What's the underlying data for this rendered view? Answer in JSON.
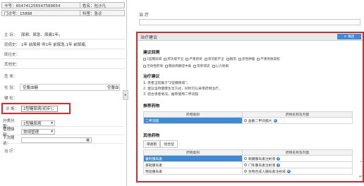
{
  "patient": {
    "card_label": "卡号：654741256547589654",
    "name_label": "姓名：包沙凡",
    "outpatient_label": "门诊号：15888",
    "dept_label": "科室：急诊"
  },
  "history": {
    "chief_label": "主 诉：",
    "chief_value": "尿频、尿急、尿痛1年。",
    "present_label": "现病史：",
    "present_value": "1年 前尿频 伴1年 前尿急,1年 前尿痛,",
    "past_label": "既往史：",
    "other_label": "其他史：",
    "exam_label": "查 体：",
    "lab_label": "化 验：",
    "lab_value": "空腹血糖",
    "lab_value2": "空腹血",
    "aux_label": "辅 检：",
    "diag_label": "诊 断：",
    "diag_value": "2型糖尿病(初步)；"
  },
  "classification": {
    "type_label": "分类分型：",
    "type_value": "2型糖尿病",
    "manage_label": "管理级别：",
    "manage_value": "常规管理",
    "followup_label": "下次随访：",
    "treat_label": "治 疗："
  },
  "right": {
    "treat_title": "治 疗"
  },
  "suggestion": {
    "title": "治疗建议",
    "confirm_label": "确定",
    "cause_title": "建议回溯",
    "causes_row1": [
      "1型糖尿病",
      "肝功能不全",
      "严重感染",
      "肾功能不全",
      "酮酒",
      "恶性肿瘤",
      "严重骨质疏松"
    ],
    "causes_row2": [
      "活动性肝病",
      "糖尿病酮症中毒",
      "有肝病史",
      "心力衰竭"
    ],
    "advice_title": "治疗建议",
    "advice_lines": [
      "1. 患者当前属于\"2型糖尿病\"。",
      "2. 建议坚持健康生活方式，同时可以采用药物治疗。",
      "3. 结合患者情况，推荐使用二甲双胍"
    ],
    "recommend_title": "推荐药物",
    "rec_headers": [
      "药物类别",
      "药物名称及剂量"
    ],
    "rec_rows": [
      {
        "category": "二甲双胍",
        "drug": "盐酸二甲双胍片"
      }
    ],
    "other_title": "其他药物",
    "tabs": [
      "单类别",
      "组合型"
    ],
    "other_headers": [
      "药物类别",
      "药物名称及剂量"
    ],
    "other_rows": [
      {
        "category": "餐时胰岛素",
        "drug": "赖脯胰岛素注射液"
      },
      {
        "category": "基础胰岛素",
        "drug": "门冬胰岛素注射液"
      },
      {
        "category": "预混胰岛素",
        "drug": "生物合成人胰岛素注射液"
      }
    ]
  },
  "colors": {
    "highlight": "#d62b2b",
    "accent": "#3c8ad8"
  }
}
